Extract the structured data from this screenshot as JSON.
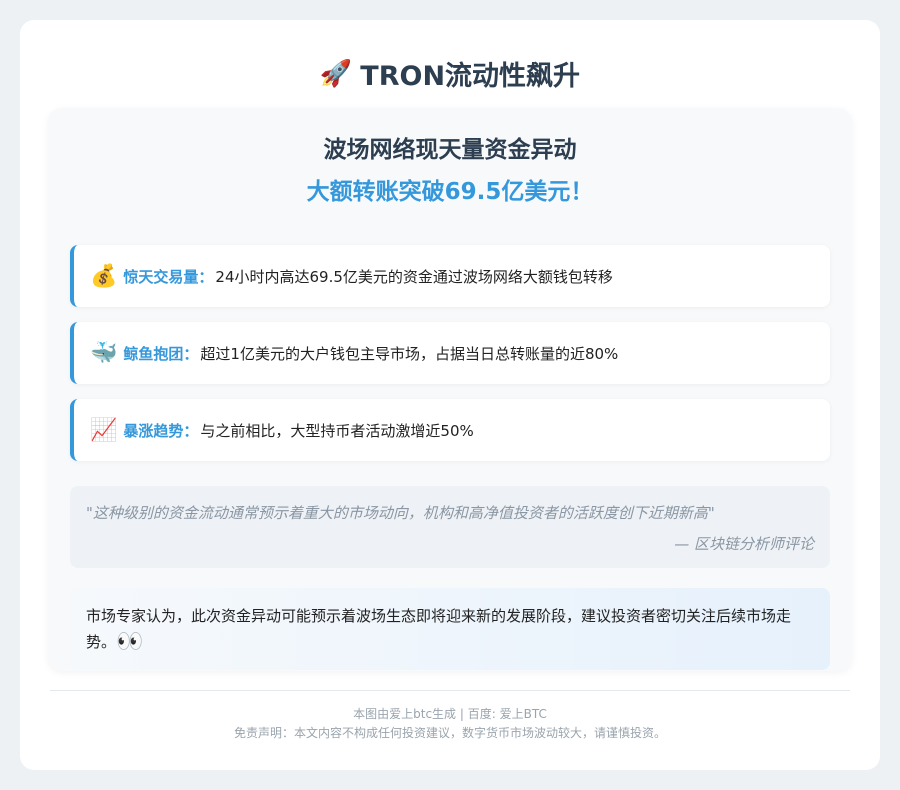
{
  "header": {
    "emoji": "🚀",
    "title": "TRON流动性飙升"
  },
  "main": {
    "subtitle1": "波场网络现天量资金异动",
    "subtitle2": "大额转账突破69.5亿美元！",
    "items": [
      {
        "icon": "money-bag-icon",
        "emoji": "💰",
        "label": "惊天交易量：",
        "text": "24小时内高达69.5亿美元的资金通过波场网络大额钱包转移"
      },
      {
        "icon": "whale-icon",
        "emoji": "🐳",
        "label": "鲸鱼抱团：",
        "text": "超过1亿美元的大户钱包主导市场，占据当日总转账量的近80%"
      },
      {
        "icon": "chart-increasing-icon",
        "emoji": "📈",
        "label": "暴涨趋势：",
        "text": "与之前相比，大型持币者活动激增近50%"
      }
    ],
    "quote": {
      "text": "\"这种级别的资金流动通常预示着重大的市场动向，机构和高净值投资者的活跃度创下近期新高\"",
      "source": "— 区块链分析师评论"
    },
    "advice": {
      "text": "市场专家认为，此次资金异动可能预示着波场生态即将迎来新的发展阶段，建议投资者密切关注后续市场走势。",
      "emoji": "👀"
    }
  },
  "footer": {
    "line1": "本图由爱上btc生成 | 百度: 爱上BTC",
    "line2": "免责声明：本文内容不构成任何投资建议，数字货币市场波动较大，请谨慎投资。"
  }
}
